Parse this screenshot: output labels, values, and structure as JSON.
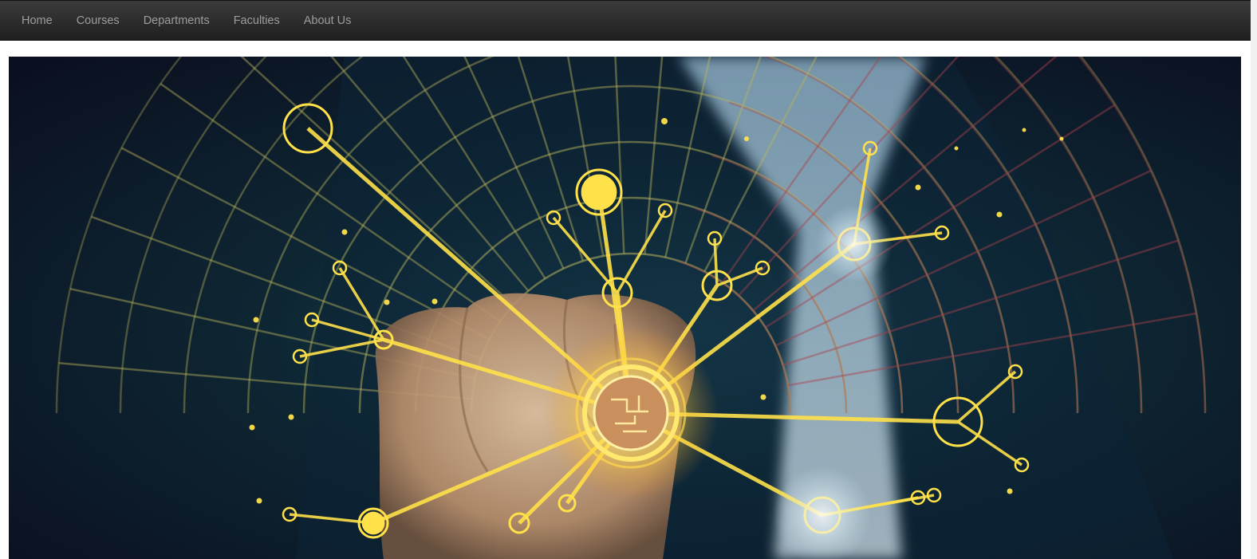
{
  "nav": {
    "items": [
      {
        "label": "Home"
      },
      {
        "label": "Courses"
      },
      {
        "label": "Departments"
      },
      {
        "label": "Faculties"
      },
      {
        "label": "About Us"
      }
    ]
  },
  "hero": {
    "image_alt": "",
    "colors": {
      "background_dark": "#0a1422",
      "network_yellow": "#ffe14a",
      "glow_white": "#eaf6ff",
      "grid_olive": "#b7b35c",
      "grid_red": "#a8434b"
    }
  }
}
